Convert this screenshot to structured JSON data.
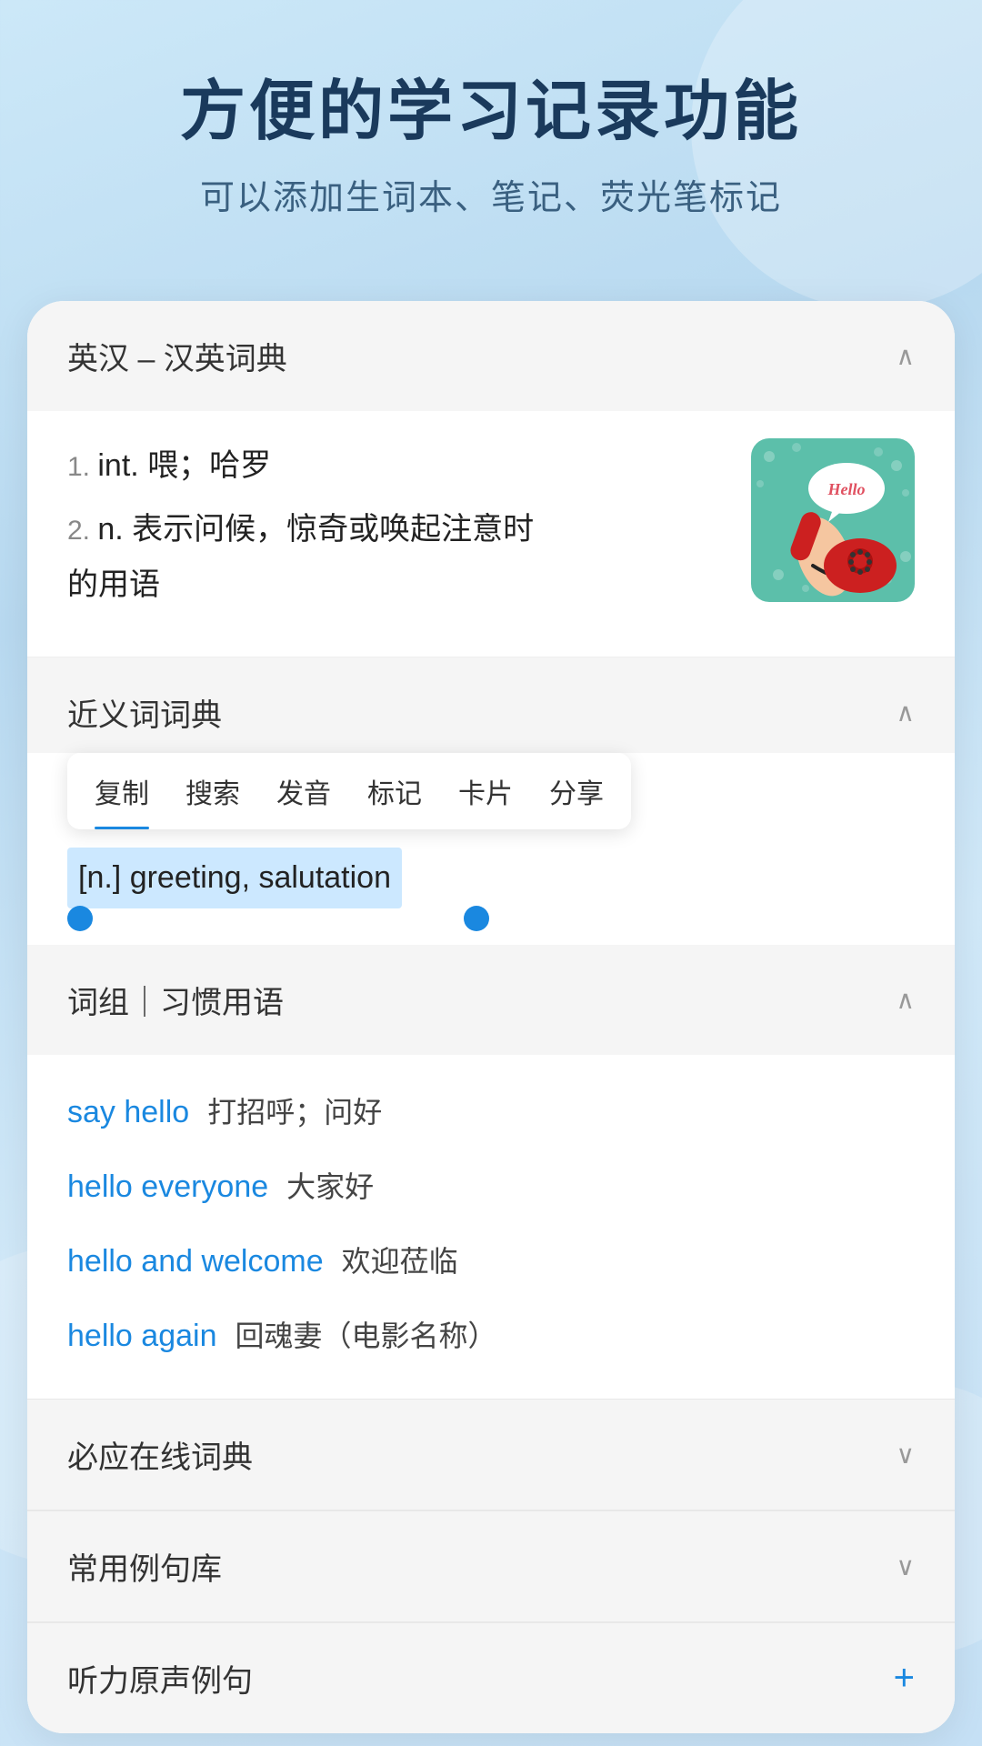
{
  "header": {
    "main_title": "方便的学习记录功能",
    "sub_title": "可以添加生词本、笔记、荧光笔标记"
  },
  "sections": {
    "english_chinese_dict": {
      "title": "英汉 – 汉英词典",
      "entries": [
        {
          "num": "1.",
          "type": "int.",
          "definition": "喂；哈罗"
        },
        {
          "num": "2.",
          "type": "n.",
          "definition": "表示问候，惊奇或唤起注意时的用语"
        }
      ],
      "image_alt": "hello telephone illustration"
    },
    "synonym_dict": {
      "title": "近义词词典",
      "context_menu_items": [
        "复制",
        "搜索",
        "发音",
        "标记",
        "卡片",
        "分享"
      ],
      "selected_text": "[n.] greeting, salutation"
    },
    "phrases": {
      "title": "词组｜习惯用语",
      "items": [
        {
          "english": "say hello",
          "chinese": "打招呼；问好"
        },
        {
          "english": "hello everyone",
          "chinese": "大家好"
        },
        {
          "english": "hello and welcome",
          "chinese": "欢迎莅临"
        },
        {
          "english": "hello again",
          "chinese": "回魂妻（电影名称）"
        }
      ]
    },
    "bing_dict": {
      "title": "必应在线词典"
    },
    "example_sentences": {
      "title": "常用例句库"
    },
    "audio_examples": {
      "title": "听力原声例句"
    }
  },
  "icons": {
    "chevron_up": "∧",
    "chevron_down": "∨",
    "plus": "+"
  },
  "colors": {
    "accent_blue": "#1a88e0",
    "dark_navy": "#1a3a5c",
    "teal_bg": "#5cbfaa",
    "selection_bg": "#cce8ff",
    "selection_handle": "#1a88e0"
  }
}
